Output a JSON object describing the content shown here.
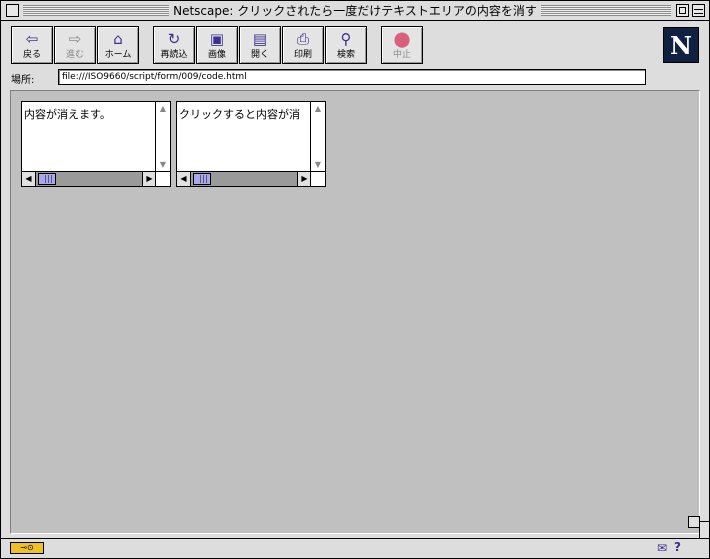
{
  "window": {
    "title": "Netscape: クリックされたら一度だけテキストエリアの内容を消す"
  },
  "toolbar": {
    "buttons": [
      {
        "label": "戻る",
        "icon": "back-arrow-icon",
        "glyph": "⇦",
        "enabled": true
      },
      {
        "label": "進む",
        "icon": "forward-arrow-icon",
        "glyph": "⇨",
        "enabled": false
      },
      {
        "label": "ホーム",
        "icon": "home-icon",
        "glyph": "⌂",
        "enabled": true
      },
      {
        "label": "再読込",
        "icon": "reload-icon",
        "glyph": "↻",
        "enabled": true
      },
      {
        "label": "画像",
        "icon": "images-icon",
        "glyph": "▣",
        "enabled": true
      },
      {
        "label": "開く",
        "icon": "open-icon",
        "glyph": "▤",
        "enabled": true
      },
      {
        "label": "印刷",
        "icon": "print-icon",
        "glyph": "⎙",
        "enabled": true
      },
      {
        "label": "検索",
        "icon": "find-icon",
        "glyph": "⚲",
        "enabled": true
      },
      {
        "label": "中止",
        "icon": "stop-icon",
        "glyph": "⬤",
        "enabled": false
      }
    ],
    "logo_letter": "N"
  },
  "location": {
    "label": "場所:",
    "url": "file:///ISO9660/script/form/009/code.html"
  },
  "content": {
    "textareas": [
      {
        "text": "内容が消えます。"
      },
      {
        "text": "クリックすると内容が消"
      }
    ]
  },
  "statusbar": {
    "text": ""
  },
  "colors": {
    "window_bg": "#dddddd",
    "content_bg": "#c0c0c0",
    "icon_accent": "#3b2f8f"
  }
}
